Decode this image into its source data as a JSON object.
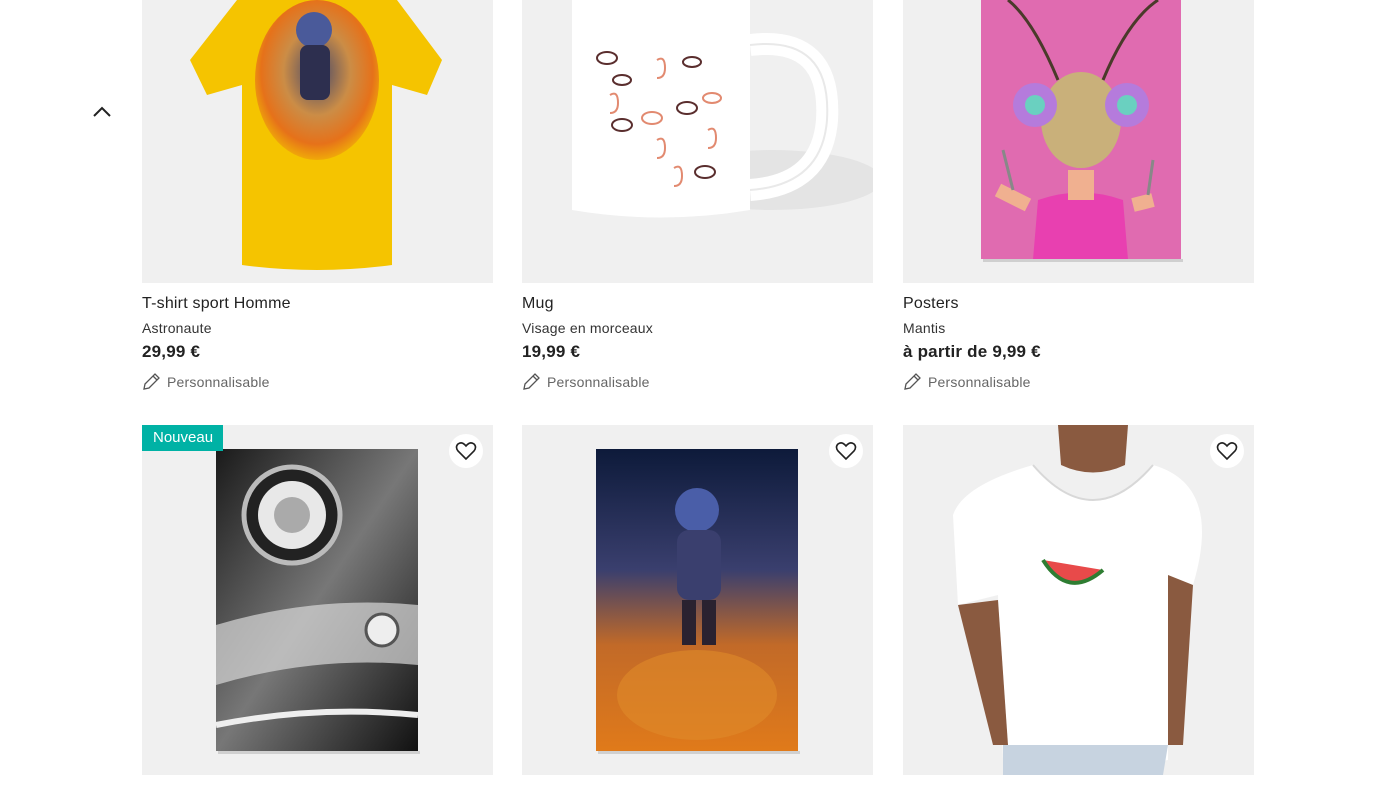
{
  "products_row1": [
    {
      "name": "T-shirt sport Homme",
      "design": "Astronaute",
      "price": "29,99 €",
      "customizable": "Personnalisable",
      "color": "#f5c400"
    },
    {
      "name": "Mug",
      "design": "Visage en morceaux",
      "price": "19,99 €",
      "customizable": "Personnalisable",
      "color": "#ffffff"
    },
    {
      "name": "Posters",
      "design": "Mantis",
      "price": "à partir de 9,99 €",
      "customizable": "Personnalisable",
      "color": "#e06bb0"
    }
  ],
  "products_row2": [
    {
      "badge": "Nouveau",
      "favorite_icon": "heart-icon"
    },
    {
      "favorite_icon": "heart-icon"
    },
    {
      "favorite_icon": "heart-icon"
    }
  ],
  "colors": {
    "badge": "#00b2a5",
    "image_bg": "#f0f0f0"
  },
  "icons": {
    "scroll_top": "chevron-up-icon",
    "customize": "pencil-icon",
    "favorite": "heart-icon"
  }
}
